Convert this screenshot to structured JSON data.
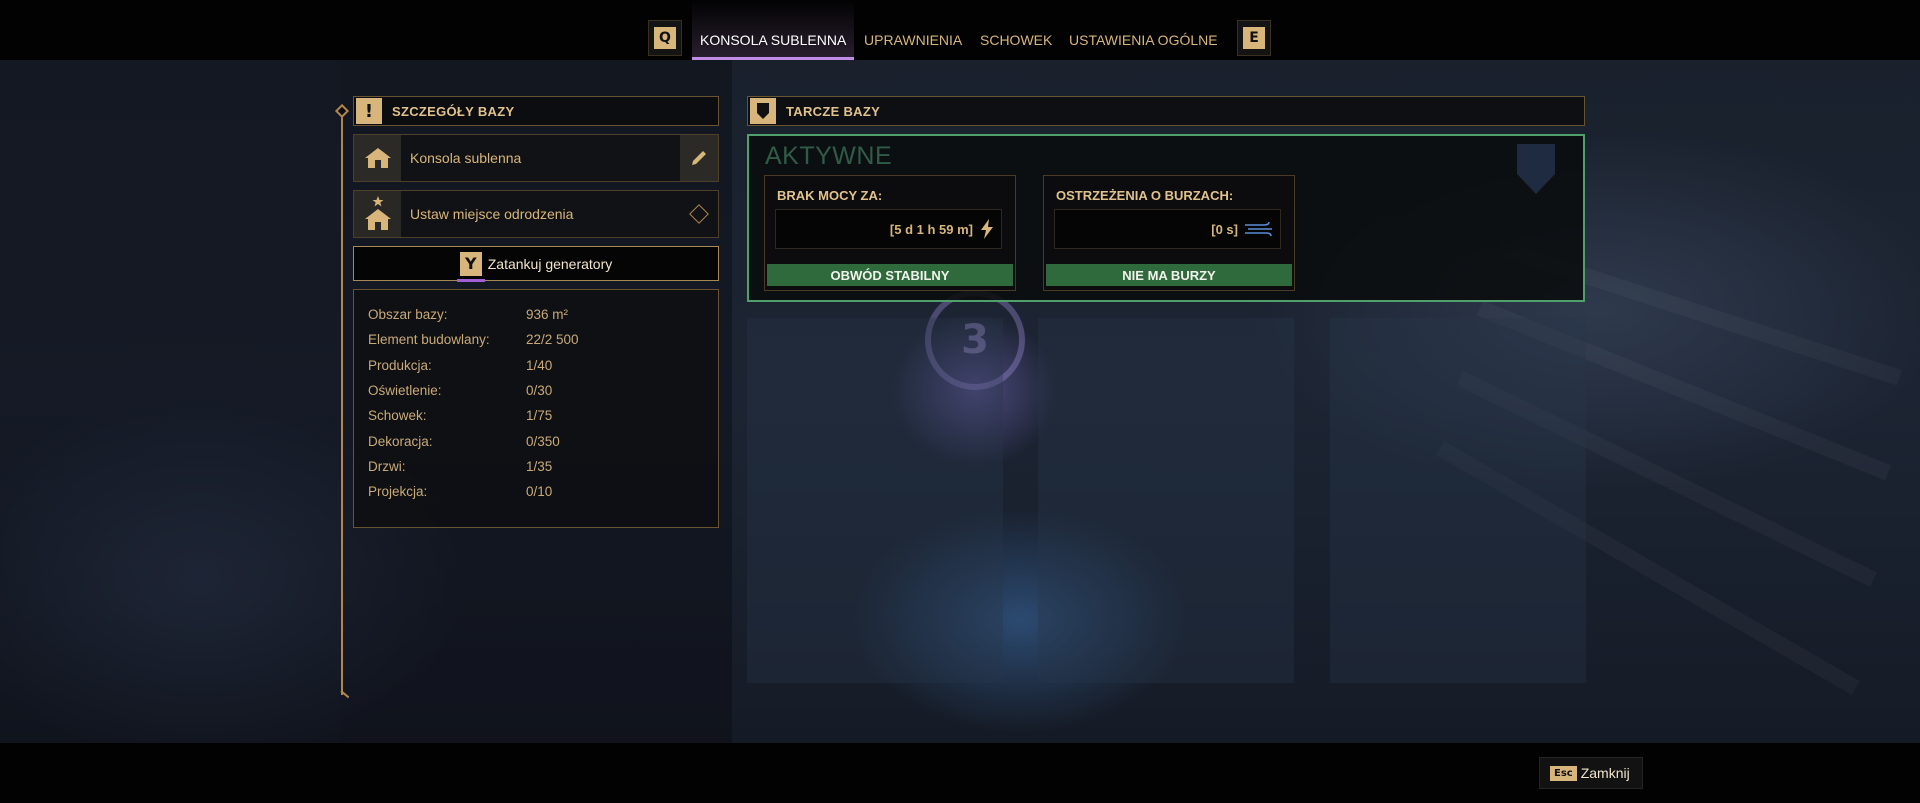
{
  "nav": {
    "prev_key": "Q",
    "next_key": "E",
    "tabs": [
      {
        "label": "KONSOLA SUBLENNA",
        "active": true
      },
      {
        "label": "UPRAWNIENIA",
        "active": false
      },
      {
        "label": "SCHOWEK",
        "active": false
      },
      {
        "label": "USTAWIENIA OGÓLNE",
        "active": false
      }
    ]
  },
  "details": {
    "header": "SZCZEGÓŁY BAZY",
    "console_name": "Konsola sublenna",
    "respawn_label": "Ustaw miejsce odrodzenia",
    "fuel_button": "Zatankuj generatory",
    "stats": [
      {
        "label": "Obszar bazy:",
        "value": "936 m²"
      },
      {
        "label": "Element budowlany:",
        "value": "22/2 500"
      },
      {
        "label": "Produkcja:",
        "value": "1/40"
      },
      {
        "label": "Oświetlenie:",
        "value": "0/30"
      },
      {
        "label": "Schowek:",
        "value": "1/75"
      },
      {
        "label": "Dekoracja:",
        "value": "0/350"
      },
      {
        "label": "Drzwi:",
        "value": "1/35"
      },
      {
        "label": "Projekcja:",
        "value": "0/10"
      }
    ]
  },
  "shields": {
    "header": "TARCZE BAZY",
    "state": "AKTYWNE",
    "power": {
      "title": "BRAK MOCY ZA:",
      "value": "[5 d 1 h 59 m]",
      "status": "OBWÓD STABILNY",
      "icon": "lightning-icon"
    },
    "storm": {
      "title": "OSTRZEŻENIA O BURZACH:",
      "value": "[0 s]",
      "status": "NIE MA BURZY",
      "icon": "wind-icon"
    },
    "status_color": "#2f6a3d",
    "border_color": "#4fa06a"
  },
  "footer": {
    "esc_key": "Esc",
    "close_label": "Zamknij"
  },
  "colors": {
    "accent": "#d8b57a",
    "active_tab": "#c08de6"
  }
}
